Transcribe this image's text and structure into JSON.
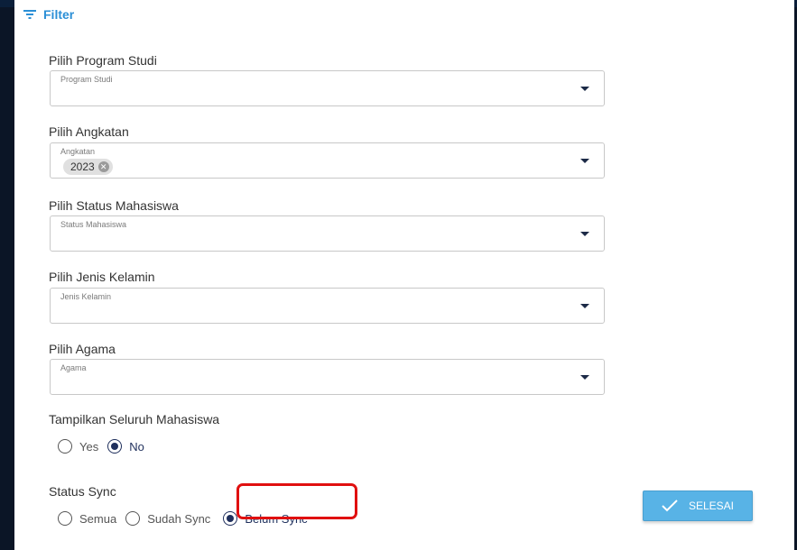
{
  "filter": {
    "title": "Filter",
    "icon": "filter-icon"
  },
  "fields": {
    "program_studi": {
      "label": "Pilih Program Studi",
      "hint": "Program Studi"
    },
    "angkatan": {
      "label": "Pilih Angkatan",
      "hint": "Angkatan",
      "chip": "2023"
    },
    "status_mahasiswa": {
      "label": "Pilih Status Mahasiswa",
      "hint": "Status Mahasiswa"
    },
    "jenis_kelamin": {
      "label": "Pilih Jenis Kelamin",
      "hint": "Jenis Kelamin"
    },
    "agama": {
      "label": "Pilih Agama",
      "hint": "Agama"
    }
  },
  "tampilkan": {
    "label": "Tampilkan Seluruh Mahasiswa",
    "options": [
      "Yes",
      "No"
    ],
    "selected": "No"
  },
  "status_sync": {
    "label": "Status Sync",
    "options": [
      "Semua",
      "Sudah Sync",
      "Belum Sync"
    ],
    "selected": "Belum Sync"
  },
  "done_button": {
    "label": "SELESAI"
  },
  "colors": {
    "accent": "#2b8fd6",
    "button": "#58b3e6",
    "highlight": "#e01010",
    "radio_checked": "#1f2f5c"
  }
}
